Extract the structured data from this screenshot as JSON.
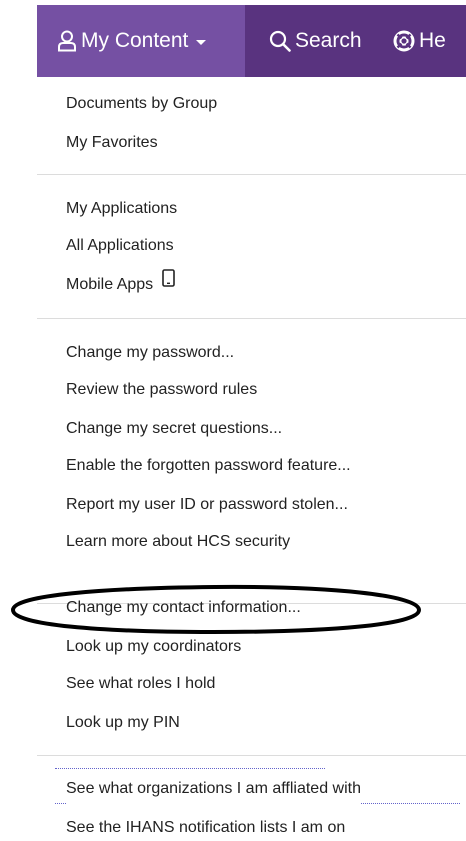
{
  "navbar": {
    "my_content": {
      "label": "My Content",
      "icon": "user-icon"
    },
    "search": {
      "label": "Search",
      "icon": "search-icon"
    },
    "help": {
      "label": "He",
      "icon": "lifebuoy-icon"
    },
    "bar_color": "#59337f",
    "active_color": "#7550a3"
  },
  "menu": {
    "groups": [
      {
        "items": [
          {
            "label": "Documents by Group"
          },
          {
            "label": "My Favorites"
          }
        ]
      },
      {
        "items": [
          {
            "label": "My Applications"
          },
          {
            "label": "All Applications"
          },
          {
            "label": "Mobile Apps",
            "icon": "mobile-phone-icon"
          }
        ]
      },
      {
        "items": [
          {
            "label": "Change my password..."
          },
          {
            "label": "Review the password rules"
          },
          {
            "label": "Change my secret questions..."
          },
          {
            "label": "Enable the forgotten password feature..."
          },
          {
            "label": "Report my user ID or password stolen..."
          },
          {
            "label": "Learn more about HCS security"
          }
        ]
      },
      {
        "items": [
          {
            "label": "Change my contact information...",
            "highlighted": true
          },
          {
            "label": "Look up my coordinators"
          },
          {
            "label": "See what roles I hold"
          },
          {
            "label": "Look up my PIN"
          }
        ]
      },
      {
        "items": [
          {
            "label": "See what organizations I am affliated with"
          },
          {
            "label": "See the IHANS notification lists I am on"
          }
        ]
      }
    ]
  }
}
